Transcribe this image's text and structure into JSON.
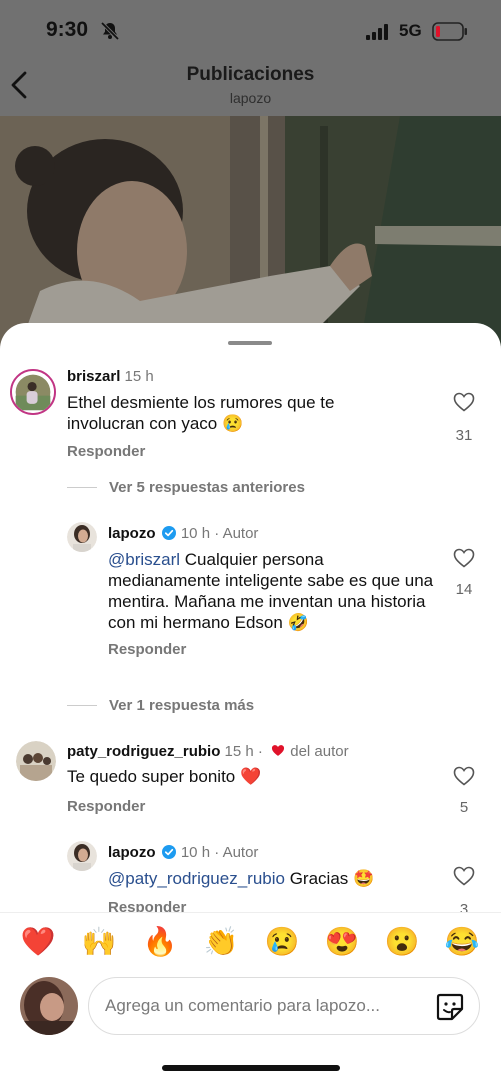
{
  "status_bar": {
    "time": "9:30",
    "network": "5G"
  },
  "header": {
    "title": "Publicaciones",
    "subtitle": "lapozo"
  },
  "comments": [
    {
      "username": "briszarl",
      "time": "15 h",
      "text": "Ethel desmiente los rumores que te involucran con yaco 😢",
      "reply_label": "Responder",
      "likes": "31"
    },
    {
      "view_more": "Ver 5 respuestas anteriores"
    },
    {
      "username": "lapozo",
      "time": "10 h",
      "separator": "·",
      "tag": "Autor",
      "mention": "@briszarl",
      "text": " Cualquier persona medianamente inteligente sabe es que una mentira. Mañana me inventan una historia con mi hermano Edson 🤣",
      "reply_label": "Responder",
      "likes": "14"
    },
    {
      "view_more": "Ver 1 respuesta más"
    },
    {
      "username": "paty_rodriguez_rubio",
      "time": "15 h",
      "separator": "·",
      "tag": "del autor",
      "text": "Te quedo super bonito ❤️",
      "reply_label": "Responder",
      "likes": "5"
    },
    {
      "username": "lapozo",
      "time": "10 h",
      "separator": "·",
      "tag": "Autor",
      "mention": "@paty_rodriguez_rubio",
      "text": " Gracias 🤩",
      "reply_label": "Responder",
      "likes": "3"
    }
  ],
  "reactions": [
    "❤️",
    "🙌",
    "🔥",
    "👏",
    "😢",
    "😍",
    "😮",
    "😂"
  ],
  "composer": {
    "placeholder": "Agrega un comentario para lapozo..."
  },
  "colors": {
    "mention": "#2a4f8e",
    "heart": "#e0122a",
    "verified": "#1d9bf0"
  }
}
